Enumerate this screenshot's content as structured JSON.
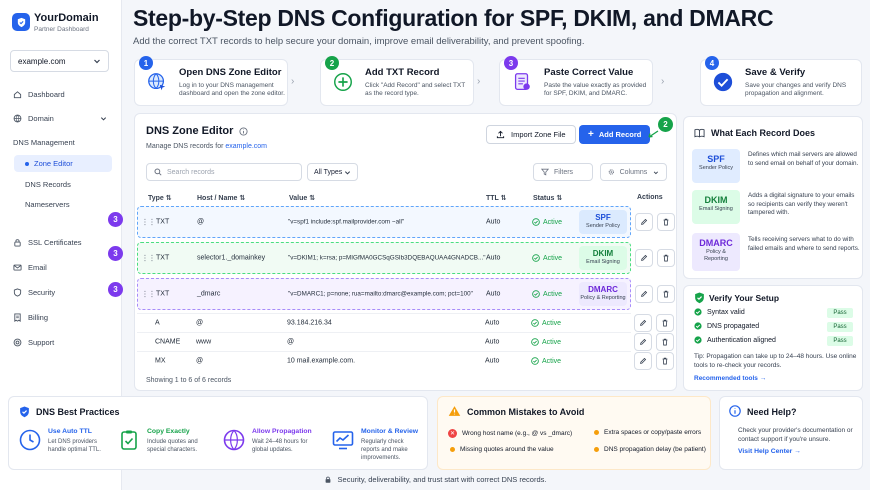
{
  "brand": {
    "name": "YourDomain",
    "subtitle": "Partner Dashboard"
  },
  "domain_select": {
    "value": "example.com"
  },
  "nav": {
    "dashboard": "Dashboard",
    "domain": "Domain",
    "dns_management": "DNS Management",
    "zone_editor": "Zone Editor",
    "dns_records": "DNS Records",
    "nameservers": "Nameservers",
    "ssl": "SSL Certificates",
    "email": "Email",
    "security": "Security",
    "billing": "Billing",
    "support": "Support"
  },
  "header": {
    "title": "Step-by-Step DNS Configuration for SPF, DKIM, and DMARC",
    "subtitle": "Add the correct TXT records to help secure your domain, improve email deliverability, and prevent spoofing."
  },
  "steps": [
    {
      "num": "1",
      "title": "Open DNS Zone Editor",
      "desc": "Log in to your DNS management dashboard and open the zone editor.",
      "color": "#2563eb"
    },
    {
      "num": "2",
      "title": "Add TXT Record",
      "desc": "Click \"Add Record\" and select TXT as the record type.",
      "color": "#16a34a"
    },
    {
      "num": "3",
      "title": "Paste Correct Value",
      "desc": "Paste the value exactly as provided for SPF, DKIM, and DMARC.",
      "color": "#7c3aed"
    },
    {
      "num": "4",
      "title": "Save & Verify",
      "desc": "Save your changes and verify DNS propagation and alignment.",
      "color": "#2563eb"
    }
  ],
  "zone": {
    "title": "DNS Zone Editor",
    "sub_prefix": "Manage DNS records for",
    "domain": "example.com",
    "import_label": "Import Zone File",
    "add_label": "Add Record",
    "add_badge": "2",
    "search_placeholder": "Search records",
    "types_value": "All Types",
    "filters_label": "Filters",
    "columns_label": "Columns",
    "headers": {
      "type": "Type",
      "host": "Host / Name",
      "value": "Value",
      "ttl": "TTL",
      "status": "Status",
      "actions": "Actions"
    },
    "row_badge": "3",
    "highlight_rows": [
      {
        "type": "TXT",
        "host": "@",
        "value": "\"v=spf1 include:spf.mailprovider.com ~all\"",
        "ttl": "Auto",
        "status": "Active",
        "tag": "SPF",
        "tag_sub": "Sender Policy",
        "border": "#60a5fa",
        "bg": "#f3f8ff",
        "tag_bg": "#dbeafe",
        "tag_color": "#1d4ed8"
      },
      {
        "type": "TXT",
        "host": "selector1._domainkey",
        "value": "\"v=DKIM1; k=rsa; p=MIGfMA0GCSqGSIb3DQEBAQUAA4GNADCB...\"",
        "ttl": "Auto",
        "status": "Active",
        "tag": "DKIM",
        "tag_sub": "Email Signing",
        "border": "#4ade80",
        "bg": "#f1fbf4",
        "tag_bg": "#dcfce7",
        "tag_color": "#15803d"
      },
      {
        "type": "TXT",
        "host": "_dmarc",
        "value": "\"v=DMARC1; p=none; rua=mailto:dmarc@example.com; pct=100\"",
        "ttl": "Auto",
        "status": "Active",
        "tag": "DMARC",
        "tag_sub": "Policy & Reporting",
        "border": "#a78bfa",
        "bg": "#f6f2ff",
        "tag_bg": "#ede9fe",
        "tag_color": "#6d28d9"
      }
    ],
    "simple_rows": [
      {
        "type": "A",
        "host": "@",
        "value": "93.184.216.34",
        "ttl": "Auto",
        "status": "Active"
      },
      {
        "type": "CNAME",
        "host": "www",
        "value": "@",
        "ttl": "Auto",
        "status": "Active"
      },
      {
        "type": "MX",
        "host": "@",
        "value": "10 mail.example.com.",
        "ttl": "Auto",
        "status": "Active"
      }
    ],
    "footer": "Showing 1 to 6 of 6 records"
  },
  "what": {
    "title": "What Each Record Does",
    "records": [
      {
        "name": "SPF",
        "sub": "Sender Policy",
        "desc": "Defines which mail servers are allowed to send email on behalf of your domain.",
        "bg": "#e0ecff",
        "color": "#1d4ed8"
      },
      {
        "name": "DKIM",
        "sub": "Email Signing",
        "desc": "Adds a digital signature to your emails so recipients can verify they weren't tampered with.",
        "bg": "#dcfce7",
        "color": "#15803d"
      },
      {
        "name": "DMARC",
        "sub": "Policy & Reporting",
        "desc": "Tells receiving servers what to do with failed emails and where to send reports.",
        "bg": "#ede9fe",
        "color": "#6d28d9"
      }
    ]
  },
  "verify": {
    "title": "Verify Your Setup",
    "items": [
      {
        "label": "Syntax valid",
        "badge": "Pass"
      },
      {
        "label": "DNS propagated",
        "badge": "Pass"
      },
      {
        "label": "Authentication aligned",
        "badge": "Pass"
      }
    ],
    "tip": "Tip: Propagation can take up to 24–48 hours. Use online tools to re-check your records.",
    "tools": "Recommended tools →"
  },
  "best": {
    "title": "DNS Best Practices",
    "items": [
      {
        "title": "Use Auto TTL",
        "desc": "Let DNS providers handle optimal TTL."
      },
      {
        "title": "Copy Exactly",
        "desc": "Include quotes and special characters."
      },
      {
        "title": "Allow Propagation",
        "desc": "Wait 24–48 hours for global updates."
      },
      {
        "title": "Monitor & Review",
        "desc": "Regularly check reports and make improvements."
      }
    ]
  },
  "mistakes": {
    "title": "Common Mistakes to Avoid",
    "left": [
      "Wrong host name (e.g., @ vs _dmarc)",
      "Missing quotes around the value"
    ],
    "right": [
      "Extra spaces or copy/paste errors",
      "DNS propagation delay (be patient)"
    ]
  },
  "help": {
    "title": "Need Help?",
    "desc": "Check your provider's documentation or contact support if you're unsure.",
    "link": "Visit Help Center →"
  },
  "footer": "Security, deliverability, and trust start with correct DNS records."
}
